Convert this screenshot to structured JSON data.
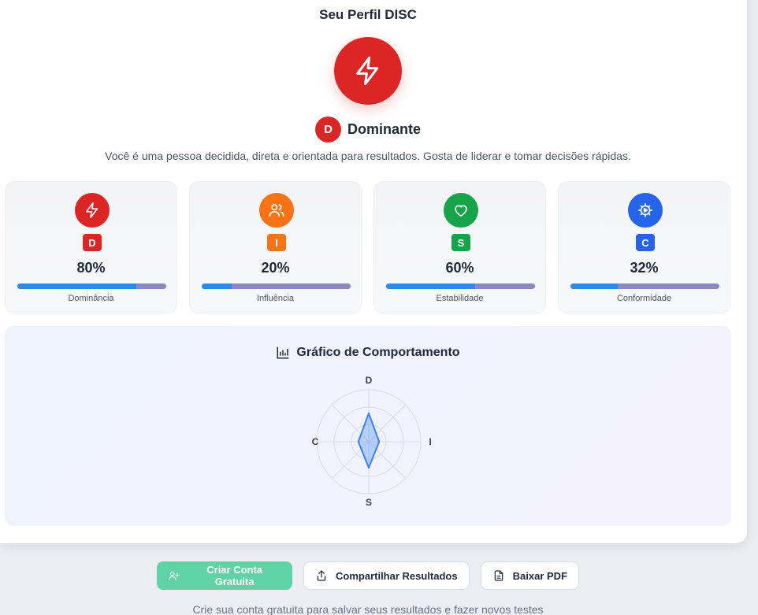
{
  "title": "Seu Perfil DISC",
  "profile": {
    "letter": "D",
    "name": "Dominante",
    "description": "Você é uma pessoa decidida, direta e orientada para resultados. Gosta de liderar e tomar decisões rápidas."
  },
  "traits": [
    {
      "letter": "D",
      "percent_text": "80%",
      "value": 0.8,
      "label": "Dominância",
      "color": "#dc2626",
      "icon": "lightning-icon"
    },
    {
      "letter": "I",
      "percent_text": "20%",
      "value": 0.2,
      "label": "Influência",
      "color": "#f97316",
      "icon": "users-icon"
    },
    {
      "letter": "S",
      "percent_text": "60%",
      "value": 0.6,
      "label": "Estabilidade",
      "color": "#16a34a",
      "icon": "heart-icon"
    },
    {
      "letter": "C",
      "percent_text": "32%",
      "value": 0.32,
      "label": "Conformidade",
      "color": "#2563eb",
      "icon": "gear-icon"
    }
  ],
  "chart_title": "Gráfico de Comportamento",
  "chart_data": {
    "type": "radar",
    "axes": [
      "D",
      "I",
      "S",
      "C"
    ],
    "values": [
      0.55,
      0.2,
      0.5,
      0.2
    ],
    "max": 1,
    "rings": 3,
    "color": "#3b82f6"
  },
  "buttons": {
    "create_account": "Criar Conta Gratuita",
    "share": "Compartilhar Resultados",
    "download": "Baixar PDF"
  },
  "footnote": "Crie sua conta gratuita para salvar seus resultados e fazer novos testes"
}
